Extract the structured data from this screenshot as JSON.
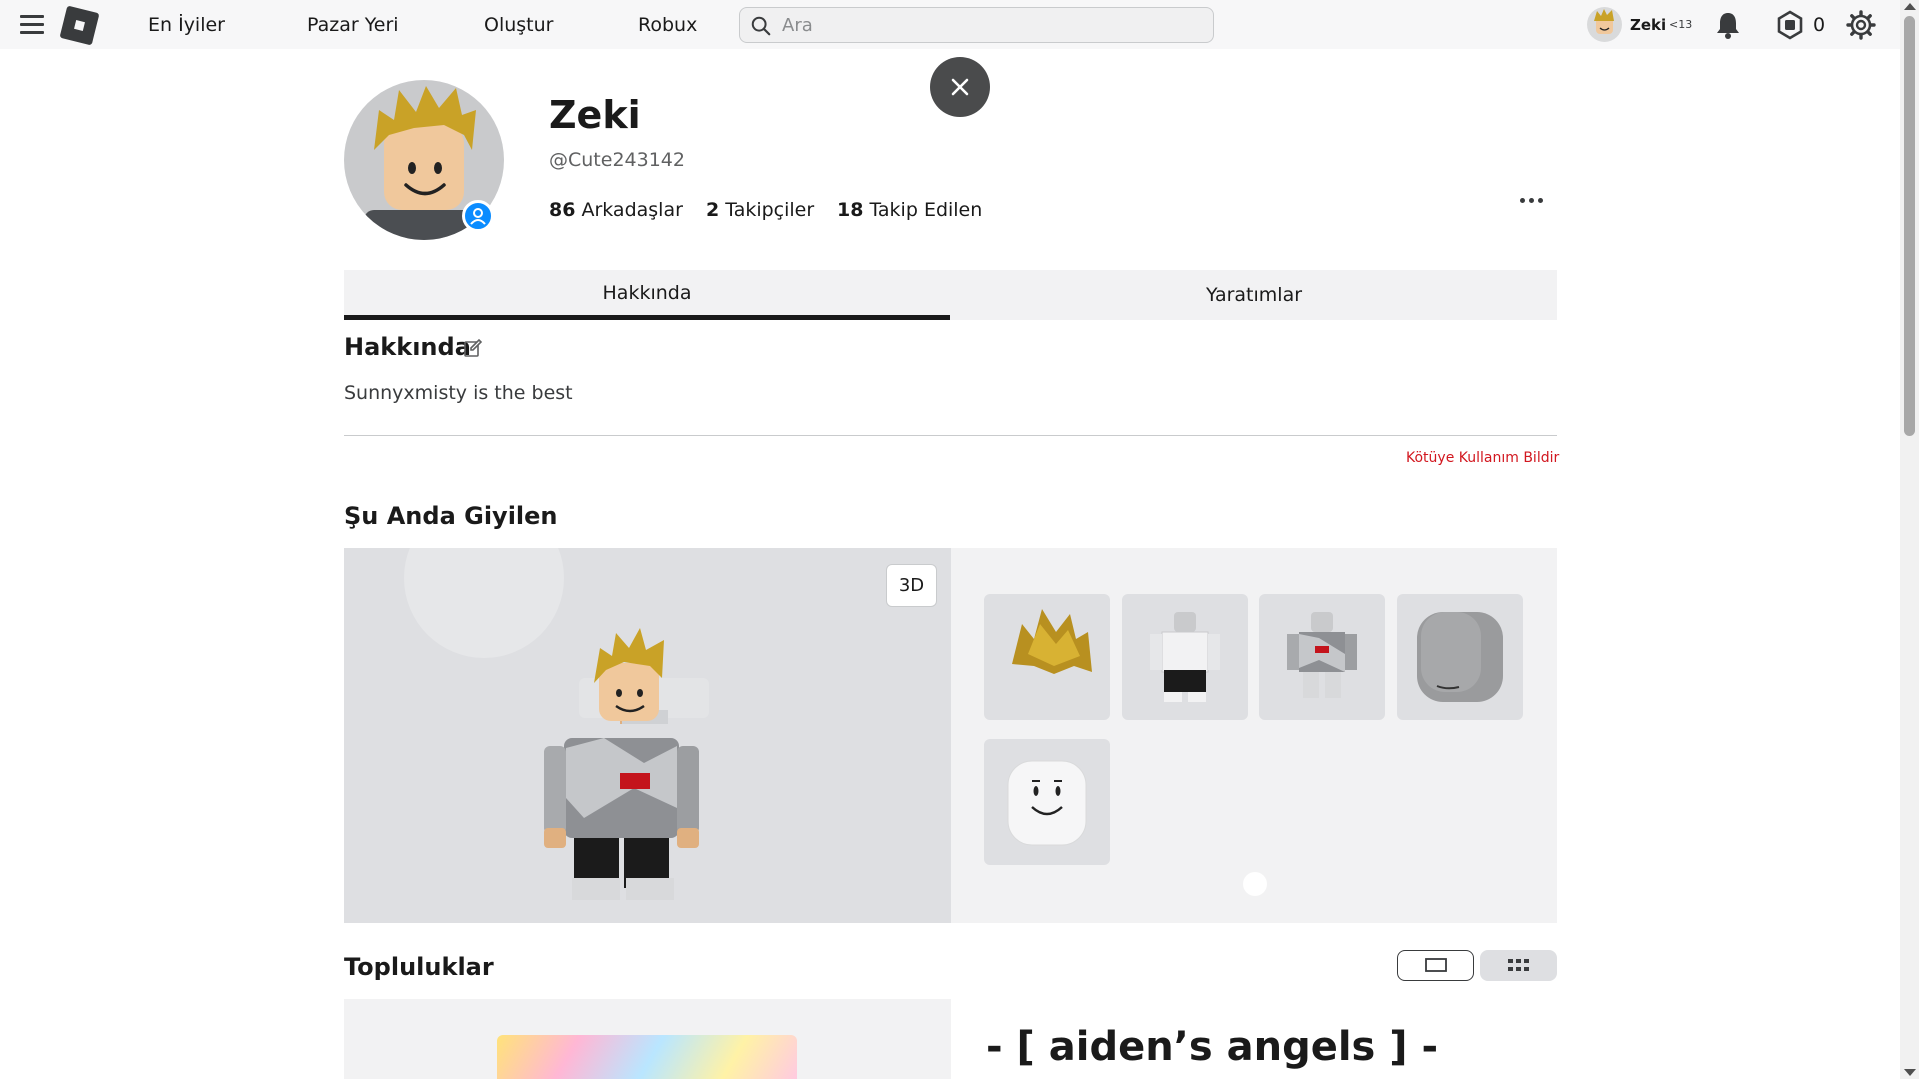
{
  "nav": {
    "links": [
      "En İyiler",
      "Pazar Yeri",
      "Oluştur",
      "Robux"
    ],
    "search_placeholder": "Ara",
    "user_name": "Zeki",
    "age_label": "<13",
    "robux_count": "0"
  },
  "profile": {
    "display_name": "Zeki",
    "username": "@Cute243142",
    "friends_count": "86",
    "friends_label": "Arkadaşlar",
    "followers_count": "2",
    "followers_label": "Takipçiler",
    "following_count": "18",
    "following_label": "Takip Edilen"
  },
  "tabs": [
    {
      "label": "Hakkında",
      "active": true
    },
    {
      "label": "Yaratımlar",
      "active": false
    }
  ],
  "about": {
    "title": "Hakkında",
    "description": "Sunnyxmisty is the best",
    "report_label": "Kötüye Kullanım Bildir"
  },
  "wearing": {
    "title": "Şu Anda Giyilen",
    "view_3d_label": "3D",
    "items": [
      "hair-item",
      "shirt-item",
      "hoodie-item",
      "head-item",
      "face-item"
    ]
  },
  "groups": {
    "title": "Topluluklar",
    "group_name": "- [ aiden’s angels ] -"
  },
  "colors": {
    "accent_blue": "#0b8cff",
    "report_red": "#d2171f",
    "nav_bg": "#f7f7f8"
  }
}
